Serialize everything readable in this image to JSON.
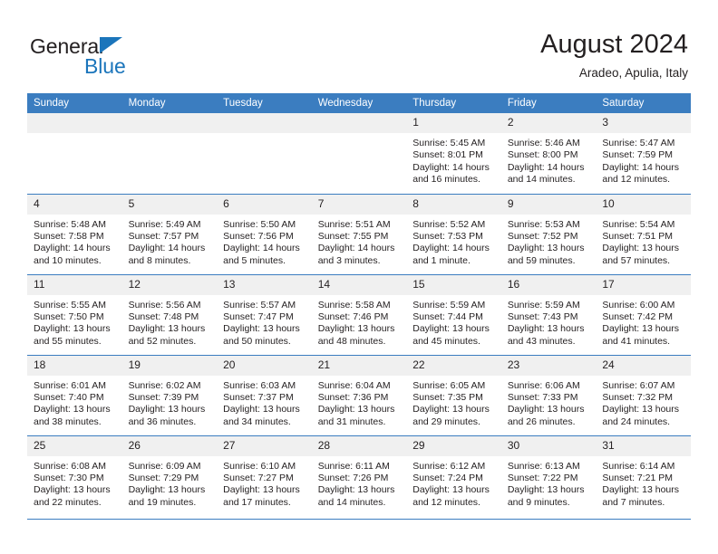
{
  "brand": {
    "name_part1": "General",
    "name_part2": "Blue",
    "accent_color": "#1b75bb"
  },
  "header": {
    "title": "August 2024",
    "subtitle": "Aradeo, Apulia, Italy"
  },
  "theme": {
    "header_blue": "#3b7dc0",
    "daynum_band": "#f0f0f0",
    "text": "#231f20"
  },
  "weekday_headers": [
    "Sunday",
    "Monday",
    "Tuesday",
    "Wednesday",
    "Thursday",
    "Friday",
    "Saturday"
  ],
  "weeks": [
    [
      {
        "day": "",
        "sunrise": "",
        "sunset": "",
        "daylight1": "",
        "daylight2": ""
      },
      {
        "day": "",
        "sunrise": "",
        "sunset": "",
        "daylight1": "",
        "daylight2": ""
      },
      {
        "day": "",
        "sunrise": "",
        "sunset": "",
        "daylight1": "",
        "daylight2": ""
      },
      {
        "day": "",
        "sunrise": "",
        "sunset": "",
        "daylight1": "",
        "daylight2": ""
      },
      {
        "day": "1",
        "sunrise": "Sunrise: 5:45 AM",
        "sunset": "Sunset: 8:01 PM",
        "daylight1": "Daylight: 14 hours",
        "daylight2": "and 16 minutes."
      },
      {
        "day": "2",
        "sunrise": "Sunrise: 5:46 AM",
        "sunset": "Sunset: 8:00 PM",
        "daylight1": "Daylight: 14 hours",
        "daylight2": "and 14 minutes."
      },
      {
        "day": "3",
        "sunrise": "Sunrise: 5:47 AM",
        "sunset": "Sunset: 7:59 PM",
        "daylight1": "Daylight: 14 hours",
        "daylight2": "and 12 minutes."
      }
    ],
    [
      {
        "day": "4",
        "sunrise": "Sunrise: 5:48 AM",
        "sunset": "Sunset: 7:58 PM",
        "daylight1": "Daylight: 14 hours",
        "daylight2": "and 10 minutes."
      },
      {
        "day": "5",
        "sunrise": "Sunrise: 5:49 AM",
        "sunset": "Sunset: 7:57 PM",
        "daylight1": "Daylight: 14 hours",
        "daylight2": "and 8 minutes."
      },
      {
        "day": "6",
        "sunrise": "Sunrise: 5:50 AM",
        "sunset": "Sunset: 7:56 PM",
        "daylight1": "Daylight: 14 hours",
        "daylight2": "and 5 minutes."
      },
      {
        "day": "7",
        "sunrise": "Sunrise: 5:51 AM",
        "sunset": "Sunset: 7:55 PM",
        "daylight1": "Daylight: 14 hours",
        "daylight2": "and 3 minutes."
      },
      {
        "day": "8",
        "sunrise": "Sunrise: 5:52 AM",
        "sunset": "Sunset: 7:53 PM",
        "daylight1": "Daylight: 14 hours",
        "daylight2": "and 1 minute."
      },
      {
        "day": "9",
        "sunrise": "Sunrise: 5:53 AM",
        "sunset": "Sunset: 7:52 PM",
        "daylight1": "Daylight: 13 hours",
        "daylight2": "and 59 minutes."
      },
      {
        "day": "10",
        "sunrise": "Sunrise: 5:54 AM",
        "sunset": "Sunset: 7:51 PM",
        "daylight1": "Daylight: 13 hours",
        "daylight2": "and 57 minutes."
      }
    ],
    [
      {
        "day": "11",
        "sunrise": "Sunrise: 5:55 AM",
        "sunset": "Sunset: 7:50 PM",
        "daylight1": "Daylight: 13 hours",
        "daylight2": "and 55 minutes."
      },
      {
        "day": "12",
        "sunrise": "Sunrise: 5:56 AM",
        "sunset": "Sunset: 7:48 PM",
        "daylight1": "Daylight: 13 hours",
        "daylight2": "and 52 minutes."
      },
      {
        "day": "13",
        "sunrise": "Sunrise: 5:57 AM",
        "sunset": "Sunset: 7:47 PM",
        "daylight1": "Daylight: 13 hours",
        "daylight2": "and 50 minutes."
      },
      {
        "day": "14",
        "sunrise": "Sunrise: 5:58 AM",
        "sunset": "Sunset: 7:46 PM",
        "daylight1": "Daylight: 13 hours",
        "daylight2": "and 48 minutes."
      },
      {
        "day": "15",
        "sunrise": "Sunrise: 5:59 AM",
        "sunset": "Sunset: 7:44 PM",
        "daylight1": "Daylight: 13 hours",
        "daylight2": "and 45 minutes."
      },
      {
        "day": "16",
        "sunrise": "Sunrise: 5:59 AM",
        "sunset": "Sunset: 7:43 PM",
        "daylight1": "Daylight: 13 hours",
        "daylight2": "and 43 minutes."
      },
      {
        "day": "17",
        "sunrise": "Sunrise: 6:00 AM",
        "sunset": "Sunset: 7:42 PM",
        "daylight1": "Daylight: 13 hours",
        "daylight2": "and 41 minutes."
      }
    ],
    [
      {
        "day": "18",
        "sunrise": "Sunrise: 6:01 AM",
        "sunset": "Sunset: 7:40 PM",
        "daylight1": "Daylight: 13 hours",
        "daylight2": "and 38 minutes."
      },
      {
        "day": "19",
        "sunrise": "Sunrise: 6:02 AM",
        "sunset": "Sunset: 7:39 PM",
        "daylight1": "Daylight: 13 hours",
        "daylight2": "and 36 minutes."
      },
      {
        "day": "20",
        "sunrise": "Sunrise: 6:03 AM",
        "sunset": "Sunset: 7:37 PM",
        "daylight1": "Daylight: 13 hours",
        "daylight2": "and 34 minutes."
      },
      {
        "day": "21",
        "sunrise": "Sunrise: 6:04 AM",
        "sunset": "Sunset: 7:36 PM",
        "daylight1": "Daylight: 13 hours",
        "daylight2": "and 31 minutes."
      },
      {
        "day": "22",
        "sunrise": "Sunrise: 6:05 AM",
        "sunset": "Sunset: 7:35 PM",
        "daylight1": "Daylight: 13 hours",
        "daylight2": "and 29 minutes."
      },
      {
        "day": "23",
        "sunrise": "Sunrise: 6:06 AM",
        "sunset": "Sunset: 7:33 PM",
        "daylight1": "Daylight: 13 hours",
        "daylight2": "and 26 minutes."
      },
      {
        "day": "24",
        "sunrise": "Sunrise: 6:07 AM",
        "sunset": "Sunset: 7:32 PM",
        "daylight1": "Daylight: 13 hours",
        "daylight2": "and 24 minutes."
      }
    ],
    [
      {
        "day": "25",
        "sunrise": "Sunrise: 6:08 AM",
        "sunset": "Sunset: 7:30 PM",
        "daylight1": "Daylight: 13 hours",
        "daylight2": "and 22 minutes."
      },
      {
        "day": "26",
        "sunrise": "Sunrise: 6:09 AM",
        "sunset": "Sunset: 7:29 PM",
        "daylight1": "Daylight: 13 hours",
        "daylight2": "and 19 minutes."
      },
      {
        "day": "27",
        "sunrise": "Sunrise: 6:10 AM",
        "sunset": "Sunset: 7:27 PM",
        "daylight1": "Daylight: 13 hours",
        "daylight2": "and 17 minutes."
      },
      {
        "day": "28",
        "sunrise": "Sunrise: 6:11 AM",
        "sunset": "Sunset: 7:26 PM",
        "daylight1": "Daylight: 13 hours",
        "daylight2": "and 14 minutes."
      },
      {
        "day": "29",
        "sunrise": "Sunrise: 6:12 AM",
        "sunset": "Sunset: 7:24 PM",
        "daylight1": "Daylight: 13 hours",
        "daylight2": "and 12 minutes."
      },
      {
        "day": "30",
        "sunrise": "Sunrise: 6:13 AM",
        "sunset": "Sunset: 7:22 PM",
        "daylight1": "Daylight: 13 hours",
        "daylight2": "and 9 minutes."
      },
      {
        "day": "31",
        "sunrise": "Sunrise: 6:14 AM",
        "sunset": "Sunset: 7:21 PM",
        "daylight1": "Daylight: 13 hours",
        "daylight2": "and 7 minutes."
      }
    ]
  ]
}
